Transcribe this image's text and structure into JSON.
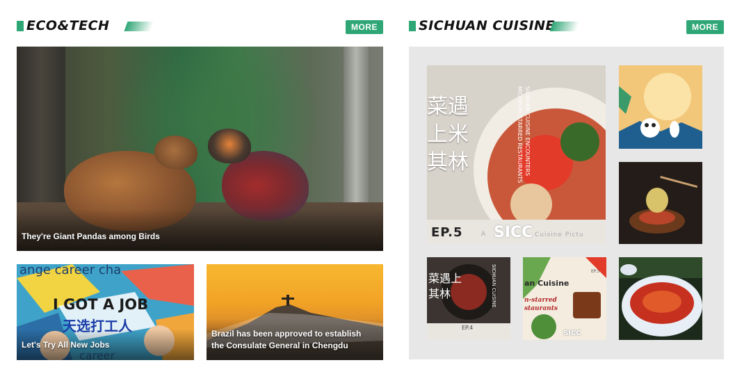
{
  "eco_tech": {
    "title": "ECO&TECH",
    "more_label": "MORE",
    "feature": {
      "caption": "They're Giant Pandas among Birds"
    },
    "cards": [
      {
        "caption": "Let's Try All New Jobs",
        "art_text_top": "ange   career cha",
        "art_text_main": "I GOT A JOB",
        "art_text_cn": "天选打工人",
        "art_text_bottom": "career"
      },
      {
        "caption": "Brazil has been approved to establish the Consulate General in Chengdu"
      }
    ]
  },
  "sichuan": {
    "title": "SICHUAN CUISINE",
    "more_label": "MORE",
    "main_tile": {
      "cn_title": "菜遇上米其林",
      "en_vertical": "SICHUAN CUISINE ENCOUNTERS MICHELIN-STARRED RESTAURANTS",
      "episode": "EP.5",
      "brand": "SICC",
      "brand_sub": "A",
      "tagline": "Cuisine Pictu"
    },
    "small_tile_2": {
      "cn_title": "菜遇上其林",
      "en_vertical": "SICHUAN CUISINE",
      "episode": "EP.4"
    },
    "small_tile_3": {
      "title": "an Cuisine",
      "subtitle": "n-starred staurants",
      "tag": "EP.3",
      "brand": "SICC"
    }
  },
  "colors": {
    "accent": "#2fa676",
    "panel": "#e7e7e7"
  }
}
